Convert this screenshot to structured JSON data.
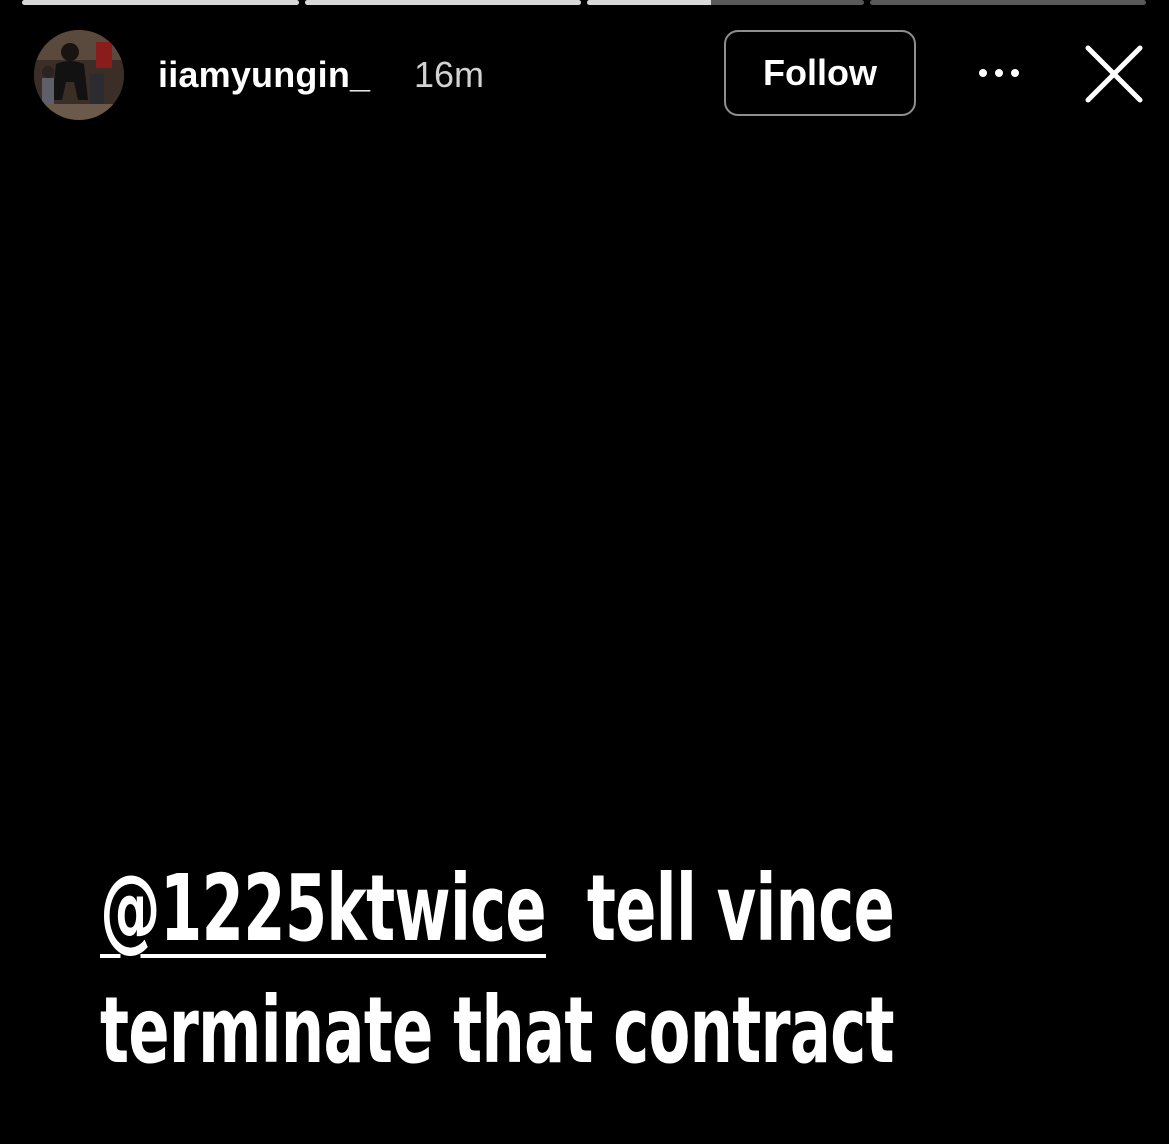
{
  "progress": [
    1.0,
    1.0,
    0.45,
    0.0
  ],
  "header": {
    "username": "iiamyungin_",
    "timestamp": "16m",
    "follow_label": "Follow",
    "more_icon": "more-horizontal-icon",
    "close_icon": "close-icon"
  },
  "story": {
    "mention": "@1225ktwice",
    "line1_rest": "tell vince",
    "line2": "terminate that contract"
  },
  "colors": {
    "background": "#000000",
    "text": "#ffffff",
    "progress_fill": "#d8d8d8",
    "progress_track": "#595959",
    "button_border": "#8e8e8e"
  }
}
